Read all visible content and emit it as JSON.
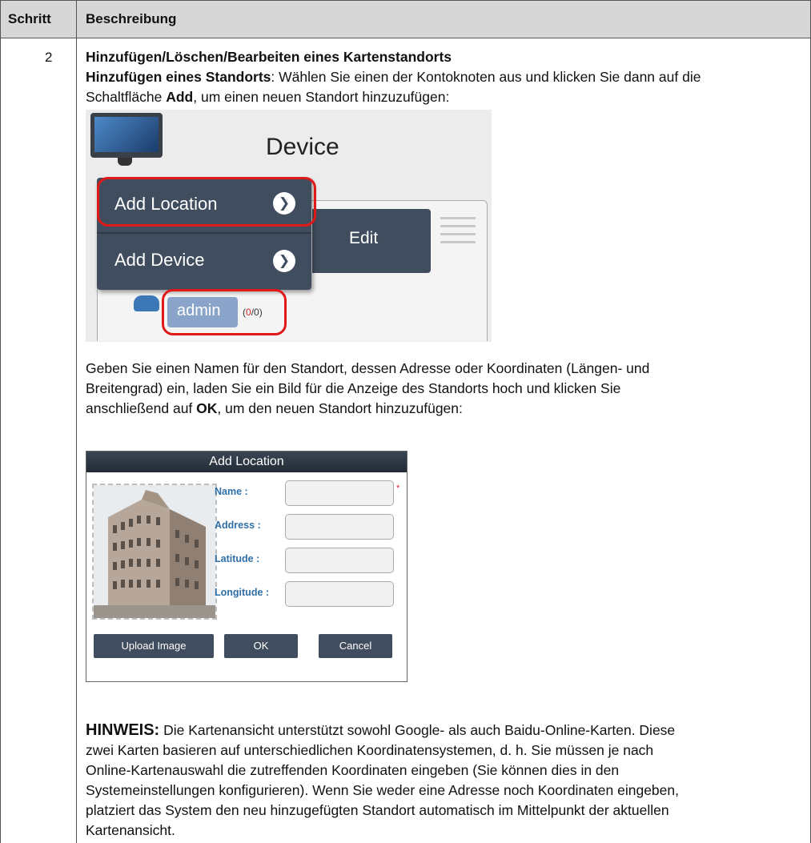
{
  "header": {
    "col_step": "Schritt",
    "col_desc": "Beschreibung"
  },
  "row": {
    "step": "2",
    "heading": "Hinzufügen/Löschen/Bearbeiten eines Kartenstandorts",
    "add_label": "Hinzufügen eines Standorts",
    "add_text_1": ": Wählen Sie einen der Kontoknoten aus und klicken Sie dann auf die",
    "add_text_2": "Schaltfläche ",
    "add_bold": "Add",
    "add_text_3": ", um einen neuen Standort hinzuzufügen:",
    "para2_line1": "Geben Sie einen Namen für den Standort, dessen Adresse oder Koordinaten (Längen- und",
    "para2_line2": "Breitengrad) ein, laden Sie ein Bild für die Anzeige des Standorts hoch und klicken Sie",
    "para2_line3a": "anschließend auf ",
    "para2_ok": "OK",
    "para2_line3b": ", um den neuen Standort hinzuzufügen:",
    "note_label": "HINWEIS:",
    "note_line1": " Die Kartenansicht unterstützt sowohl Google- als auch Baidu-Online-Karten. Diese",
    "note_line2": "zwei Karten basieren auf unterschiedlichen Koordinatensystemen, d. h. Sie müssen je nach",
    "note_line3": "Online-Kartenauswahl die zutreffenden Koordinaten eingeben (Sie können dies in den",
    "note_line4": "Systemeinstellungen konfigurieren). Wenn Sie weder eine Adresse noch Koordinaten eingeben,",
    "note_line5": "platziert das System den neu hinzugefügten Standort automatisch im Mittelpunkt der aktuellen",
    "note_line6": "Kartenansicht."
  },
  "screenshot1": {
    "device_label": "Device",
    "menu": [
      "Add Location",
      "Add Device"
    ],
    "edit_label": "Edit",
    "account": "admin",
    "count_red": "0",
    "count_rest": "/0)",
    "count_open": "(",
    "chevron_icon": "chevron-right-icon",
    "highlight_color": "#e01818"
  },
  "screenshot2": {
    "title": "Add Location",
    "fields": [
      "Name :",
      "Address :",
      "Latitude :",
      "Longitude :"
    ],
    "required_mark": "*",
    "buttons": {
      "upload": "Upload Image",
      "ok": "OK",
      "cancel": "Cancel"
    }
  }
}
